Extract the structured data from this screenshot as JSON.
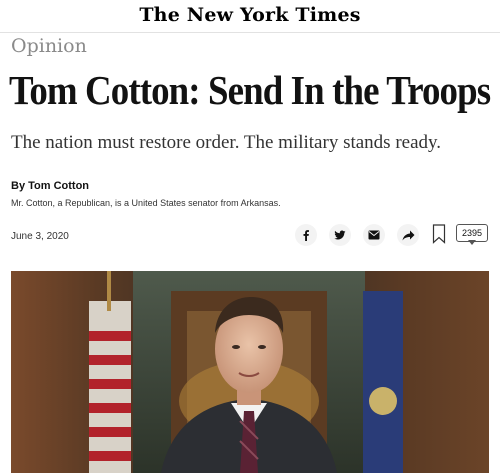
{
  "masthead": {
    "logo": "The New York Times"
  },
  "article": {
    "section": "Opinion",
    "headline": "Tom Cotton: Send In the Troops",
    "summary": "The nation must restore order. The military stands ready.",
    "byline": "By Tom Cotton",
    "author_bio": "Mr. Cotton, a Republican, is a United States senator from Arkansas.",
    "date": "June 3, 2020"
  },
  "share": {
    "icons": [
      "facebook-icon",
      "twitter-icon",
      "email-icon",
      "share-arrow-icon",
      "bookmark-icon"
    ],
    "comment_count": "2395"
  },
  "colors": {
    "text": "#121212",
    "section_gray": "#8a8a8a",
    "button_bg": "#f3f3f3"
  }
}
